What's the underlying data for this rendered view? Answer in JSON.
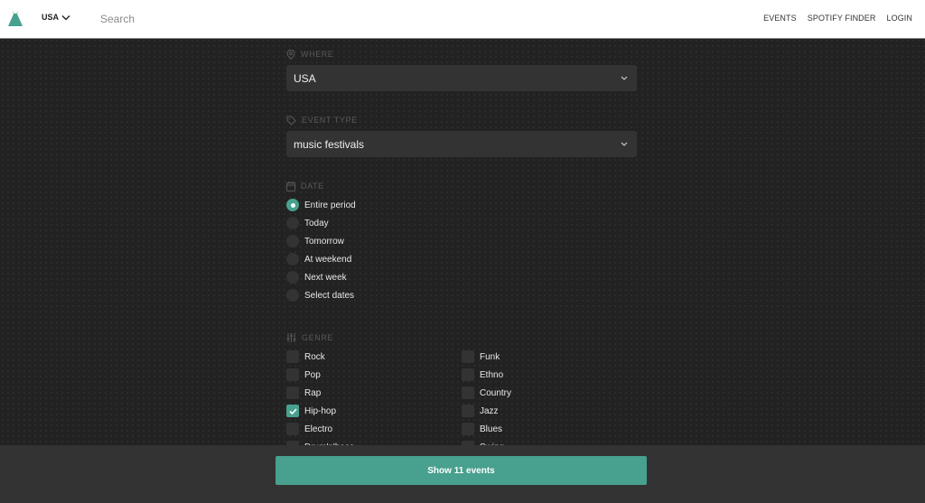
{
  "header": {
    "logo_icon": "tent-icon",
    "country": "USA",
    "search_placeholder": "Search",
    "nav": [
      "EVENTS",
      "SPOTIFY FINDER",
      "LOGIN"
    ]
  },
  "filters": {
    "where": {
      "label": "WHERE",
      "icon": "location-pin-icon",
      "value": "USA"
    },
    "event_type": {
      "label": "EVENT TYPE",
      "icon": "tag-icon",
      "value": "music festivals"
    },
    "date": {
      "label": "DATE",
      "icon": "calendar-icon",
      "options": [
        "Entire period",
        "Today",
        "Tomorrow",
        "At weekend",
        "Next week",
        "Select dates"
      ],
      "selected": "Entire period"
    },
    "genre": {
      "label": "GENRE",
      "icon": "sliders-icon",
      "left": [
        {
          "label": "Rock",
          "checked": false
        },
        {
          "label": "Pop",
          "checked": false
        },
        {
          "label": "Rap",
          "checked": false
        },
        {
          "label": "Hip-hop",
          "checked": true
        },
        {
          "label": "Electro",
          "checked": false
        },
        {
          "label": "Drum'n'bass",
          "checked": false
        }
      ],
      "right": [
        {
          "label": "Funk",
          "checked": false
        },
        {
          "label": "Ethno",
          "checked": false
        },
        {
          "label": "Country",
          "checked": false
        },
        {
          "label": "Jazz",
          "checked": false
        },
        {
          "label": "Blues",
          "checked": false
        },
        {
          "label": "Swing",
          "checked": false
        }
      ]
    }
  },
  "footer": {
    "show_button": "Show 11 events"
  },
  "colors": {
    "accent": "#48a08e",
    "background": "#222222",
    "field": "#333333"
  }
}
